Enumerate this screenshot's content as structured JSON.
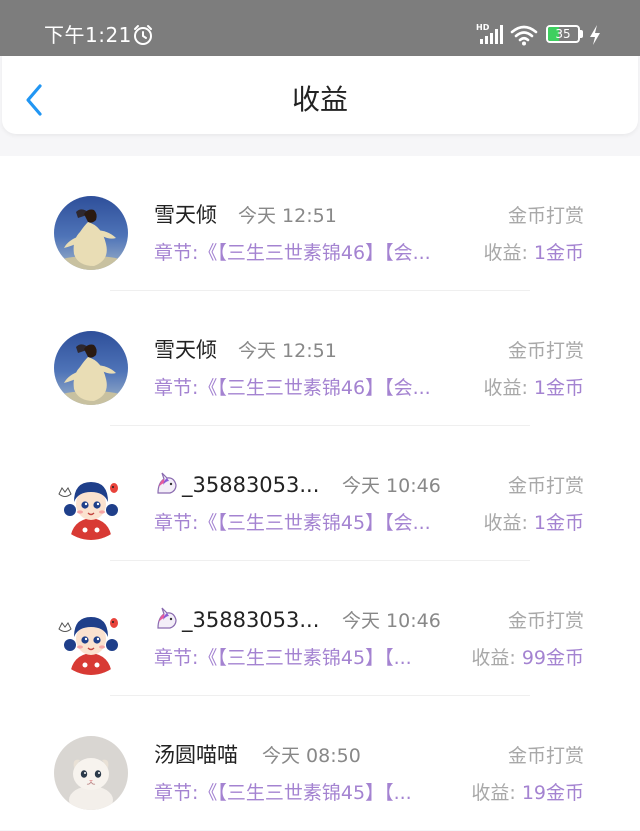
{
  "status_bar": {
    "time": "下午1:21",
    "battery": "35",
    "battery_level": 0.35
  },
  "header": {
    "title": "收益"
  },
  "colors": {
    "accent_purple": "#a483d1",
    "back_blue": "#2196f3",
    "battery_green": "#3ecf5f"
  },
  "items": [
    {
      "name": "雪天倾",
      "time": "今天 12:51",
      "type": "金币打赏",
      "chapter": "章节:《【三生三世素锦46】【会...",
      "earning_label": "收益: ",
      "earning_value": "1金币",
      "avatar": "dancer-avatar"
    },
    {
      "name": "雪天倾",
      "time": "今天 12:51",
      "type": "金币打赏",
      "chapter": "章节:《【三生三世素锦46】【会...",
      "earning_label": "收益: ",
      "earning_value": "1金币",
      "avatar": "dancer-avatar"
    },
    {
      "name": "_35883053...",
      "name_icon": "unicorn-icon",
      "time": "今天 10:46",
      "type": "金币打赏",
      "chapter": "章节:《【三生三世素锦45】【会...",
      "earning_label": "收益: ",
      "earning_value": "1金币",
      "avatar": "cartoon-girl-avatar"
    },
    {
      "name": "_35883053...",
      "name_icon": "unicorn-icon",
      "time": "今天 10:46",
      "type": "金币打赏",
      "chapter": "章节:《【三生三世素锦45】【...",
      "earning_label": "收益: ",
      "earning_value": "99金币",
      "avatar": "cartoon-girl-avatar"
    },
    {
      "name": "汤圆喵喵",
      "time": "今天 08:50",
      "type": "金币打赏",
      "chapter": "章节:《【三生三世素锦45】【...",
      "earning_label": "收益: ",
      "earning_value": "19金币",
      "avatar": "kitten-avatar"
    }
  ]
}
